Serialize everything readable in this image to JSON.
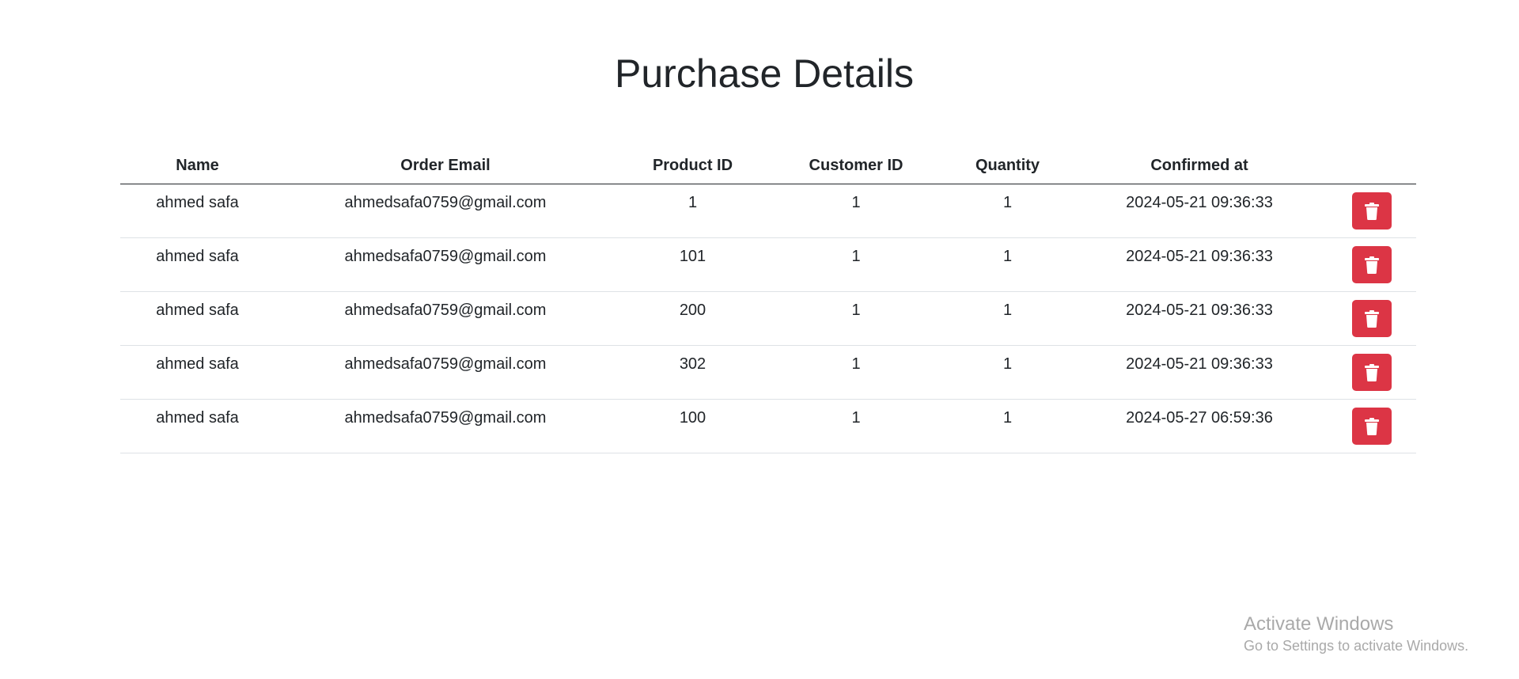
{
  "page": {
    "title": "Purchase Details"
  },
  "table": {
    "headers": {
      "name": "Name",
      "email": "Order Email",
      "product_id": "Product ID",
      "customer_id": "Customer ID",
      "quantity": "Quantity",
      "confirmed_at": "Confirmed at",
      "action": ""
    },
    "rows": [
      {
        "name": "ahmed safa",
        "email": "ahmedsafa0759@gmail.com",
        "product_id": "1",
        "customer_id": "1",
        "quantity": "1",
        "confirmed_at": "2024-05-21 09:36:33",
        "action_icon": "trash-icon"
      },
      {
        "name": "ahmed safa",
        "email": "ahmedsafa0759@gmail.com",
        "product_id": "101",
        "customer_id": "1",
        "quantity": "1",
        "confirmed_at": "2024-05-21 09:36:33",
        "action_icon": "trash-icon"
      },
      {
        "name": "ahmed safa",
        "email": "ahmedsafa0759@gmail.com",
        "product_id": "200",
        "customer_id": "1",
        "quantity": "1",
        "confirmed_at": "2024-05-21 09:36:33",
        "action_icon": "trash-icon"
      },
      {
        "name": "ahmed safa",
        "email": "ahmedsafa0759@gmail.com",
        "product_id": "302",
        "customer_id": "1",
        "quantity": "1",
        "confirmed_at": "2024-05-21 09:36:33",
        "action_icon": "trash-icon"
      },
      {
        "name": "ahmed safa",
        "email": "ahmedsafa0759@gmail.com",
        "product_id": "100",
        "customer_id": "1",
        "quantity": "1",
        "confirmed_at": "2024-05-27 06:59:36",
        "action_icon": "trash-icon"
      }
    ]
  },
  "watermark": {
    "title": "Activate Windows",
    "subtitle": "Go to Settings to activate Windows."
  },
  "colors": {
    "delete_button": "#dc3545",
    "text": "#212529",
    "row_divider": "#dee2e6",
    "watermark": "#a9a9a9"
  }
}
